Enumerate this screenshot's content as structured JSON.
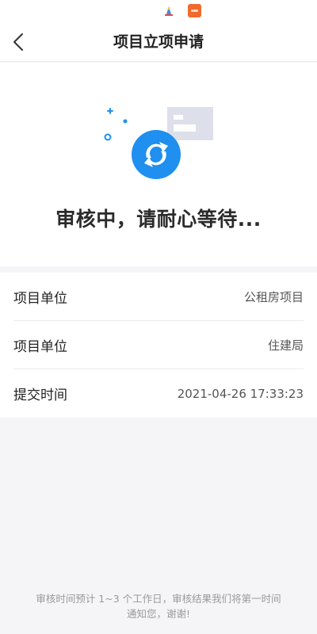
{
  "header": {
    "title": "项目立项申请",
    "back_icon": "chevron-left-icon"
  },
  "status": {
    "text": "审核中，请耐心等待...",
    "icon": "refresh-icon",
    "accent_color": "#1f8ff0"
  },
  "info": {
    "rows": [
      {
        "label": "项目单位",
        "value": "公租房项目"
      },
      {
        "label": "项目单位",
        "value": "住建局"
      },
      {
        "label": "提交时间",
        "value": "2021-04-26 17:33:23"
      }
    ]
  },
  "footer": {
    "note": "审核时间预计 1~3 个工作日，审核结果我们将第一时间通知您，谢谢!"
  }
}
